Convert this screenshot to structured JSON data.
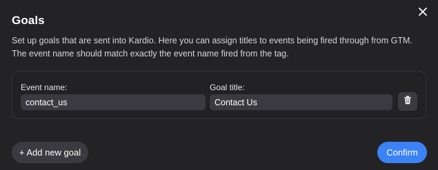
{
  "dialog": {
    "title": "Goals",
    "description": "Set up goals that are sent into Kardio. Here you can assign titles to events being fired through from GTM. The event name should match exactly the event name fired from the tag.",
    "close_icon": "close-icon"
  },
  "goals": [
    {
      "event_name_label": "Event name:",
      "event_name_value": "contact_us",
      "goal_title_label": "Goal title:",
      "goal_title_value": "Contact Us",
      "delete_icon": "trash-icon"
    }
  ],
  "footer": {
    "add_goal_label": "+ Add new goal",
    "confirm_label": "Confirm"
  },
  "colors": {
    "background": "#232326",
    "input_bg": "#3a3a40",
    "accent": "#3b82f6"
  }
}
